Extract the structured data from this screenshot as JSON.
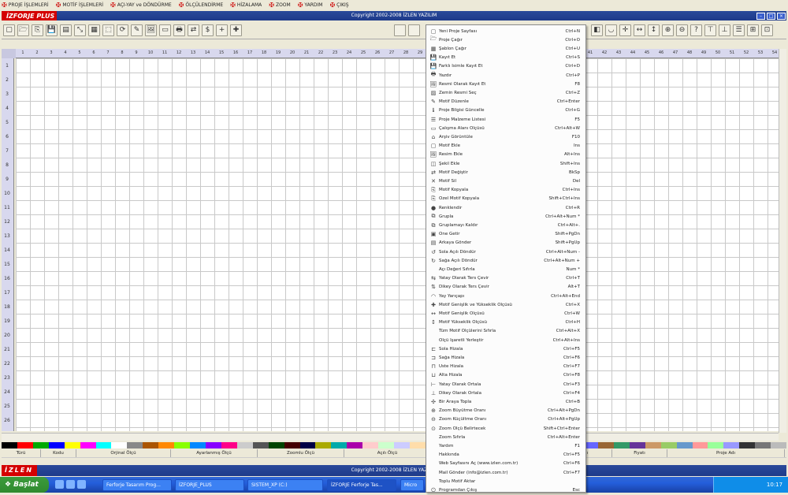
{
  "menubar": [
    {
      "label": "PROJE İŞLEMLERİ",
      "icon": "cross-icon"
    },
    {
      "label": "MOTİF İŞLEMLERİ",
      "icon": "cross-icon"
    },
    {
      "label": "AÇI-YAY ve DÖNDÜRME",
      "icon": "cross-icon"
    },
    {
      "label": "ÖLÇÜLENDİRME",
      "icon": "cross-icon"
    },
    {
      "label": "HİZALAMA",
      "icon": "cross-icon"
    },
    {
      "label": "ZOOM",
      "icon": "cross-icon"
    },
    {
      "label": "YARDIM",
      "icon": "cross-icon"
    },
    {
      "label": "ÇIKIŞ",
      "icon": "cross-icon"
    }
  ],
  "window": {
    "logo": "İZFORJE PLUS",
    "copyright": "Copyright 2002-2008 İZLEN YAZILIM"
  },
  "ruler": {
    "columns": [
      "1",
      "2",
      "3",
      "4",
      "5",
      "6",
      "7",
      "8",
      "9",
      "10",
      "11",
      "12",
      "13",
      "14",
      "15",
      "16",
      "17",
      "18",
      "19",
      "20",
      "21",
      "22",
      "23",
      "24",
      "25",
      "26",
      "27",
      "28",
      "29",
      "30",
      "31",
      "32",
      "33",
      "34",
      "35",
      "36",
      "37",
      "38",
      "39",
      "40",
      "41",
      "42",
      "43",
      "44",
      "45",
      "46",
      "47",
      "48",
      "49",
      "50",
      "51",
      "52",
      "53",
      "54"
    ],
    "rows": [
      "1",
      "2",
      "3",
      "4",
      "5",
      "6",
      "7",
      "8",
      "9",
      "10",
      "11",
      "12",
      "13",
      "14",
      "15",
      "16",
      "17",
      "18",
      "19",
      "20",
      "21",
      "22",
      "23",
      "24",
      "25",
      "26"
    ]
  },
  "status": {
    "columns": [
      "Türü",
      "Kodu",
      "Orjinal Ölçü",
      "Ayarlanmış Ölçü",
      "Zoomlu Ölçü",
      "Açılı Ölçü",
      "",
      "Ağırlığı",
      "Fiyatı",
      "Proje Adı"
    ]
  },
  "bottombar": {
    "logo": "İZLEN",
    "copyright": "Copyright 2002-2008 İZLEN YAZILIM"
  },
  "taskbar": {
    "start": "Başlat",
    "tasks": [
      "Ferforje Tasarım Prog...",
      "İZFORJE_PLUS",
      "SISTEM_XP (C:)",
      "İZFORJE Ferforje Tas...",
      "Micro"
    ],
    "clock": "10:17"
  },
  "context_menu": [
    {
      "label": "Yeni Proje Sayfası",
      "shortcut": "Ctrl+N",
      "icon": "new-page-icon"
    },
    {
      "label": "Proje Çağır",
      "shortcut": "Ctrl+O",
      "icon": "open-icon"
    },
    {
      "label": "Şablon Çağır",
      "shortcut": "Ctrl+U",
      "icon": "template-icon"
    },
    {
      "label": "Kayıt Et",
      "shortcut": "Ctrl+S",
      "icon": "save-icon"
    },
    {
      "label": "Farklı İsimle Kayıt Et",
      "shortcut": "Ctrl+D",
      "icon": "save-as-icon"
    },
    {
      "label": "Yazdır",
      "shortcut": "Ctrl+P",
      "icon": "print-icon"
    },
    {
      "label": "Resmi Olarak Kayıt Et",
      "shortcut": "F8",
      "icon": "image-save-icon"
    },
    {
      "label": "Zemin Resmi Seç",
      "shortcut": "Ctrl+Z",
      "icon": "background-icon"
    },
    {
      "label": "Motif Düzenle",
      "shortcut": "Ctrl+Enter",
      "icon": "edit-icon"
    },
    {
      "label": "Proje Bilgisi Güncelle",
      "shortcut": "Ctrl+G",
      "icon": "info-icon"
    },
    {
      "label": "Proje Malzeme Listesi",
      "shortcut": "F5",
      "icon": "list-icon"
    },
    {
      "label": "Çalışma Alanı Ölçüsü",
      "shortcut": "Ctrl+Alt+W",
      "icon": "workspace-icon"
    },
    {
      "label": "Arşiv Görüntüle",
      "shortcut": "F10",
      "icon": "archive-icon"
    },
    {
      "label": "Motif Ekle",
      "shortcut": "Ins",
      "icon": "add-motif-icon"
    },
    {
      "label": "Resim Ekle",
      "shortcut": "Alt+Ins",
      "icon": "add-image-icon"
    },
    {
      "label": "Şekil Ekle",
      "shortcut": "Shift+Ins",
      "icon": "add-shape-icon"
    },
    {
      "label": "Motif Değiştir",
      "shortcut": "BkSp",
      "icon": "change-icon"
    },
    {
      "label": "Motif Sil",
      "shortcut": "Del",
      "icon": "delete-icon"
    },
    {
      "label": "Motif Kopyala",
      "shortcut": "Ctrl+Ins",
      "icon": "copy-icon"
    },
    {
      "label": "Özel Motif Kopyala",
      "shortcut": "Shift+Ctrl+Ins",
      "icon": "special-copy-icon"
    },
    {
      "label": "Renklendir",
      "shortcut": "Ctrl+R",
      "icon": "color-icon"
    },
    {
      "label": "Grupla",
      "shortcut": "Ctrl+Alt+Num *",
      "icon": "group-icon"
    },
    {
      "label": "Gruplamayı Kaldır",
      "shortcut": "Ctrl+Alt+.",
      "icon": "ungroup-icon"
    },
    {
      "label": "Öne Getir",
      "shortcut": "Shift+PgDn",
      "icon": "bring-front-icon"
    },
    {
      "label": "Arkaya Gönder",
      "shortcut": "Shift+PgUp",
      "icon": "send-back-icon"
    },
    {
      "label": "Sola Açılı Döndür",
      "shortcut": "Ctrl+Alt+Num -",
      "icon": "rotate-left-icon"
    },
    {
      "label": "Sağa Açılı Döndür",
      "shortcut": "Ctrl+Alt+Num +",
      "icon": "rotate-right-icon"
    },
    {
      "label": "Açı Değeri Sıfırla",
      "shortcut": "Num *",
      "icon": ""
    },
    {
      "label": "Yatay Olarak Ters Çevir",
      "shortcut": "Ctrl+T",
      "icon": "flip-h-icon"
    },
    {
      "label": "Dikey Olarak Ters Çevir",
      "shortcut": "Alt+T",
      "icon": "flip-v-icon"
    },
    {
      "label": "Yay Yarıçapı",
      "shortcut": "Ctrl+Alt+End",
      "icon": "arc-icon"
    },
    {
      "label": "Motif Genişlik ve Yükseklik Ölçüsü",
      "shortcut": "Ctrl+X",
      "icon": "size-icon"
    },
    {
      "label": "Motif Genişlik Ölçüsü",
      "shortcut": "Ctrl+W",
      "icon": "width-icon"
    },
    {
      "label": "Motif Yükseklik Ölçüsü",
      "shortcut": "Ctrl+H",
      "icon": "height-icon"
    },
    {
      "label": "Tüm Motif Ölçülerini Sıfırla",
      "shortcut": "Ctrl+Alt+X",
      "icon": ""
    },
    {
      "label": "Ölçü İşaretli Yerleştir",
      "shortcut": "Ctrl+Alt+Ins",
      "icon": ""
    },
    {
      "label": "Sola Hizala",
      "shortcut": "Ctrl+F5",
      "icon": "align-left-icon"
    },
    {
      "label": "Sağa Hizala",
      "shortcut": "Ctrl+F6",
      "icon": "align-right-icon"
    },
    {
      "label": "Üste Hizala",
      "shortcut": "Ctrl+F7",
      "icon": "align-top-icon"
    },
    {
      "label": "Alta Hizala",
      "shortcut": "Ctrl+F8",
      "icon": "align-bottom-icon"
    },
    {
      "label": "Yatay Olarak Ortala",
      "shortcut": "Ctrl+F3",
      "icon": "center-h-icon"
    },
    {
      "label": "Dikey Olarak Ortala",
      "shortcut": "Ctrl+F4",
      "icon": "center-v-icon"
    },
    {
      "label": "Bir Araya Topla",
      "shortcut": "Ctrl+B",
      "icon": "gather-icon"
    },
    {
      "label": "Zoom Büyütme Oranı",
      "shortcut": "Ctrl+Alt+PgDn",
      "icon": "zoom-in-icon"
    },
    {
      "label": "Zoom Küçültme Oranı",
      "shortcut": "Ctrl+Alt+PgUp",
      "icon": "zoom-out-icon"
    },
    {
      "label": "Zoom Ölçü Belirtecek",
      "shortcut": "Shift+Ctrl+Enter",
      "icon": "zoom-measure-icon"
    },
    {
      "label": "Zoom Sıfırla",
      "shortcut": "Ctrl+Alt+Enter",
      "icon": ""
    },
    {
      "label": "Yardım",
      "shortcut": "F1",
      "icon": ""
    },
    {
      "label": "Hakkında",
      "shortcut": "Ctrl+F5",
      "icon": ""
    },
    {
      "label": "Web Sayfasını Aç (www.izlen.com.tr)",
      "shortcut": "Ctrl+F6",
      "icon": ""
    },
    {
      "label": "Mail Gönder (info@izlen.com.tr)",
      "shortcut": "Ctrl+F7",
      "icon": ""
    },
    {
      "label": "Toplu Motif Aktar",
      "shortcut": "",
      "icon": ""
    },
    {
      "label": "Programdan Çıkış",
      "shortcut": "Esc",
      "icon": "exit-icon"
    }
  ],
  "colors": {
    "accent": "#d40000",
    "titlebar": "#1e3a8a",
    "grid": "#c9c9c9"
  },
  "palette": [
    "#000000",
    "#ff0000",
    "#00aa00",
    "#0000ff",
    "#ffff00",
    "#ff00ff",
    "#00ffff",
    "#ffffff",
    "#888888",
    "#aa5500",
    "#ff8800",
    "#88ff00",
    "#0088ff",
    "#8800ff",
    "#ff0088",
    "#cccccc",
    "#555555",
    "#004400",
    "#440000",
    "#000044",
    "#aaaa00",
    "#00aaaa",
    "#aa00aa",
    "#ffcccc",
    "#ccffcc",
    "#ccccff",
    "#ffddaa",
    "#ddaaff",
    "#aaffdd",
    "#663300",
    "#336600",
    "#003366",
    "#990000",
    "#009900",
    "#000099",
    "#ff6666",
    "#66ff66",
    "#6666ff",
    "#996633",
    "#339966",
    "#663399",
    "#cc9966",
    "#99cc66",
    "#6699cc",
    "#ff9999",
    "#99ff99",
    "#9999ff",
    "#333333",
    "#777777",
    "#bbbbbb"
  ]
}
